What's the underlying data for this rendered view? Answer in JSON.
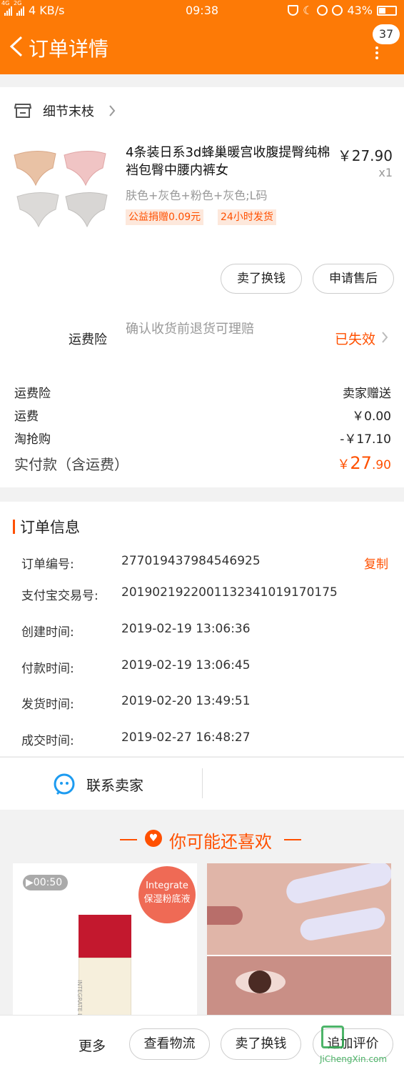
{
  "statusbar": {
    "network": "4G",
    "network2": "2G",
    "speed": "4 KB/s",
    "time": "09:38",
    "battery": "43%",
    "battery_level": 0.43
  },
  "nav": {
    "title": "订单详情",
    "badge": "37"
  },
  "shop": {
    "name": "细节末枝"
  },
  "product": {
    "title": "4条装日系3d蜂巢暖宫收腹提臀纯棉裆包臀中腰内裤女",
    "price": "￥27.90",
    "qty": "x1",
    "sku": "肤色+灰色+粉色+灰色;L码",
    "tags": [
      "公益捐赠0.09元",
      "24小时发货"
    ],
    "buttons": [
      "卖了换钱",
      "申请售后"
    ]
  },
  "insurance": {
    "label": "运费险",
    "desc": "确认收货前退货可理赔",
    "status": "已失效"
  },
  "costs": [
    {
      "label": "运费险",
      "value": "卖家赠送"
    },
    {
      "label": "运费",
      "value": "￥0.00"
    },
    {
      "label": "淘抢购",
      "value": "-￥17.10"
    }
  ],
  "total": {
    "label": "实付款（含运费）",
    "symbol": "￥",
    "int": "27",
    "dec": ".90"
  },
  "order_info": {
    "title": "订单信息",
    "copy": "复制",
    "rows": [
      {
        "label": "订单编号:",
        "value": "277019437984546925"
      },
      {
        "label": "支付宝交易号:",
        "value": "2019021922001132341019170175"
      },
      {
        "label": "创建时间:",
        "value": "2019-02-19 13:06:36"
      },
      {
        "label": "付款时间:",
        "value": "2019-02-19 13:06:45"
      },
      {
        "label": "发货时间:",
        "value": "2019-02-20 13:49:51"
      },
      {
        "label": "成交时间:",
        "value": "2019-02-27 16:48:27"
      }
    ]
  },
  "contact": {
    "label": "联系卖家"
  },
  "recommend": {
    "title": "你可能还喜欢",
    "item1": {
      "video": "00:50",
      "badge_line1": "Integrate",
      "badge_line2": "保湿粉底液",
      "bottle_text": "INTEGRATE LIQUID FOUNDATION"
    }
  },
  "bottombar": {
    "more": "更多",
    "buttons": [
      "查看物流",
      "卖了换钱",
      "追加评价"
    ]
  },
  "watermark": "JiChengXin.com",
  "colors": {
    "header": "#fd7a06",
    "accent": "#ff5000"
  }
}
